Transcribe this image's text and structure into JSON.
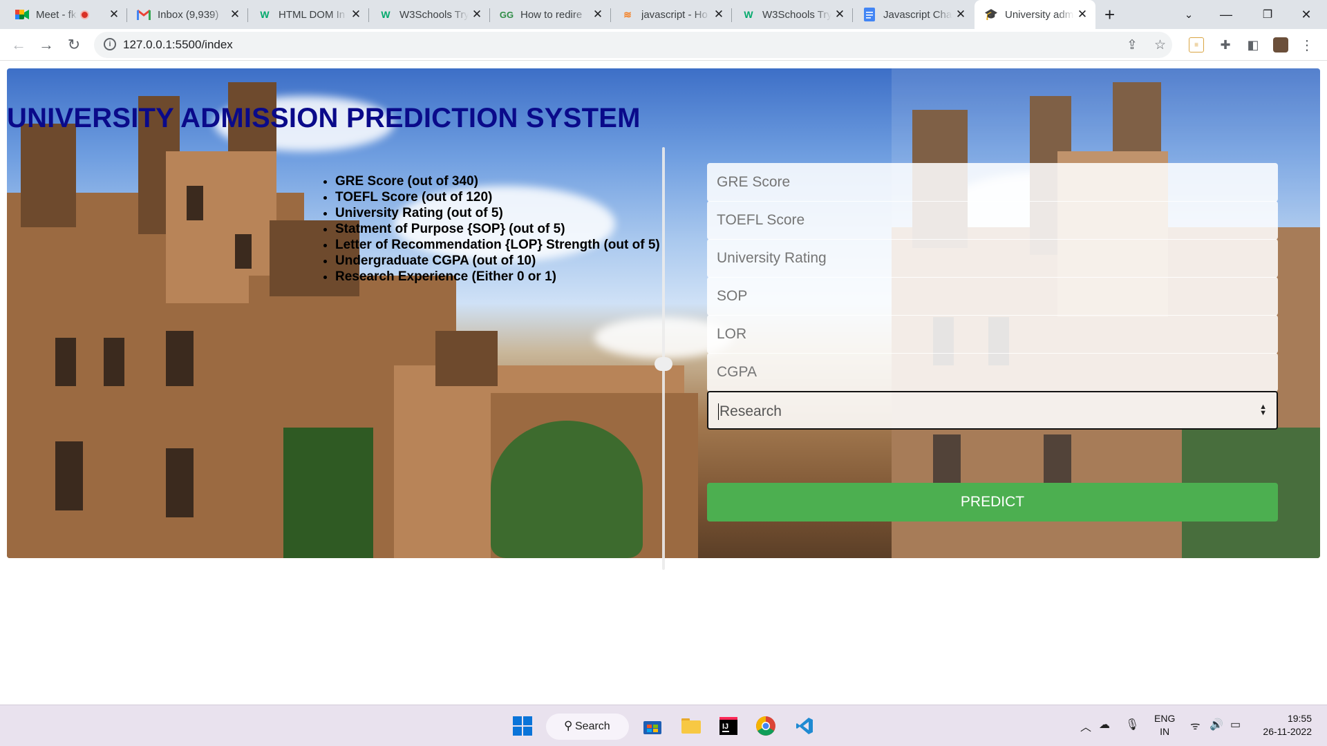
{
  "browser": {
    "tabs": [
      {
        "title": "Meet - fki",
        "favicon": "meet-icon",
        "active": false
      },
      {
        "title": "Inbox (9,939)",
        "favicon": "gmail-icon",
        "active": false
      },
      {
        "title": "HTML DOM In",
        "favicon": "w3schools-icon",
        "active": false
      },
      {
        "title": "W3Schools Try",
        "favicon": "w3schools-icon",
        "active": false
      },
      {
        "title": "How to redire",
        "favicon": "geeksforgeeks-icon",
        "active": false
      },
      {
        "title": "javascript - Ho",
        "favicon": "stackoverflow-icon",
        "active": false
      },
      {
        "title": "W3Schools Try",
        "favicon": "w3schools-icon",
        "active": false
      },
      {
        "title": "Javascript Cha",
        "favicon": "docs-icon",
        "active": false
      },
      {
        "title": "University adm",
        "favicon": "graduation-cap-icon",
        "active": true
      }
    ],
    "url": "127.0.0.1:5500/index"
  },
  "page": {
    "title": "UNIVERSITY ADMISSION PREDICTION SYSTEM",
    "requirements": [
      "GRE Score (out of 340)",
      "TOEFL Score (out of 120)",
      "University Rating (out of 5)",
      "Statment of Purpose {SOP} (out of 5)",
      "Letter of Recommendation {LOP} Strength (out of 5)",
      "Undergraduate CGPA (out of 10)",
      "Research Experience (Either 0 or 1)"
    ],
    "form": {
      "gre_placeholder": "GRE Score",
      "toefl_placeholder": "TOEFL Score",
      "rating_placeholder": "University Rating",
      "sop_placeholder": "SOP",
      "lor_placeholder": "LOR",
      "cgpa_placeholder": "CGPA",
      "research_placeholder": "Research",
      "predict_label": "PREDICT"
    },
    "colors": {
      "title": "#0a0a8a",
      "predict_button": "#4caf50"
    }
  },
  "taskbar": {
    "search_label": "Search",
    "lang_top": "ENG",
    "lang_bottom": "IN",
    "time": "19:55",
    "date": "26-11-2022"
  }
}
